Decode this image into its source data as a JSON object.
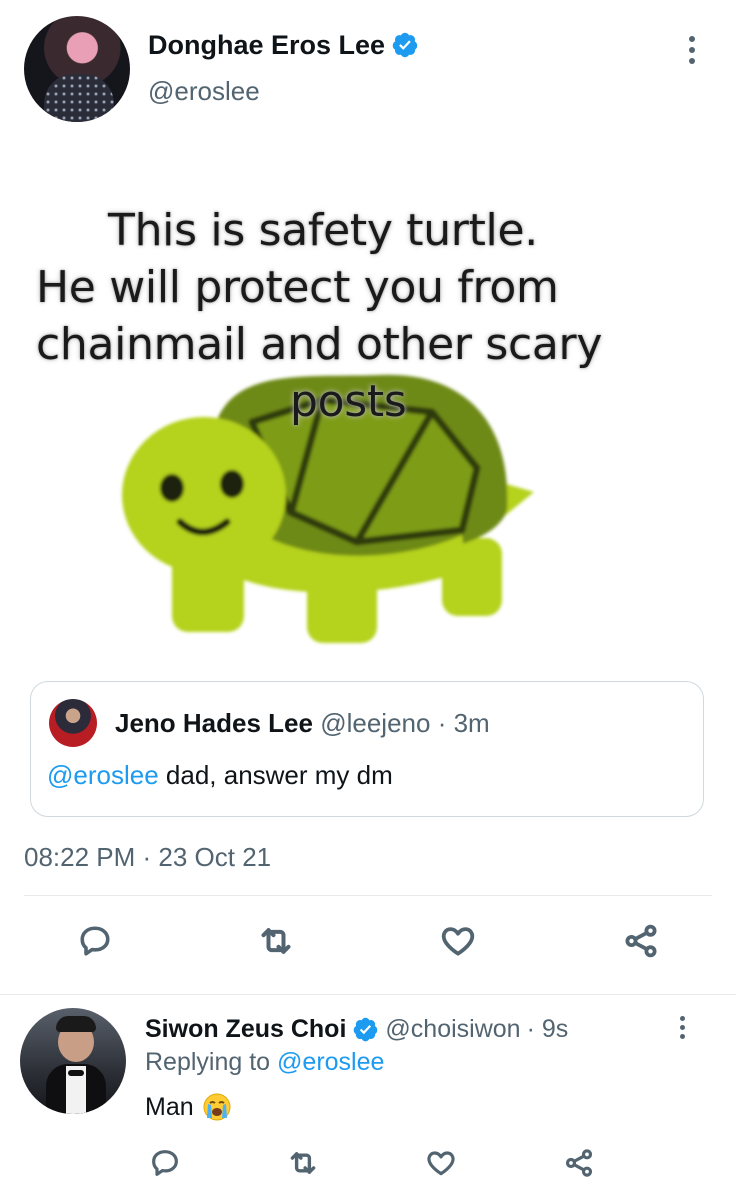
{
  "main_tweet": {
    "author_name": "Donghae Eros Lee",
    "author_handle": "@eroslee",
    "image_text": [
      "This is safety turtle.",
      "He will protect you from",
      "chainmail and other scary",
      "posts"
    ],
    "timestamp": "08:22 PM · 23 Oct 21"
  },
  "quoted_tweet": {
    "author_name": "Jeno Hades Lee",
    "author_handle": "@leejeno",
    "time": "· 3m",
    "mention": "@eroslee",
    "body": "dad, answer my dm"
  },
  "reply": {
    "author_name": "Siwon Zeus Choi",
    "author_handle": "@choisiwon",
    "time": "· 9s",
    "replying_label": "Replying to",
    "replying_handle": "@eroslee",
    "body": "Man",
    "emoji": "😭"
  },
  "icons": {
    "verified": "verified-badge-icon",
    "more": "more-vertical-icon",
    "reply": "reply-icon",
    "retweet": "retweet-icon",
    "like": "heart-icon",
    "share": "share-icon"
  },
  "colors": {
    "accent": "#1d9bf0",
    "text": "#0f1419",
    "muted": "#536471",
    "turtle_body": "#b5d21e",
    "turtle_shell": "#5e7a10"
  }
}
